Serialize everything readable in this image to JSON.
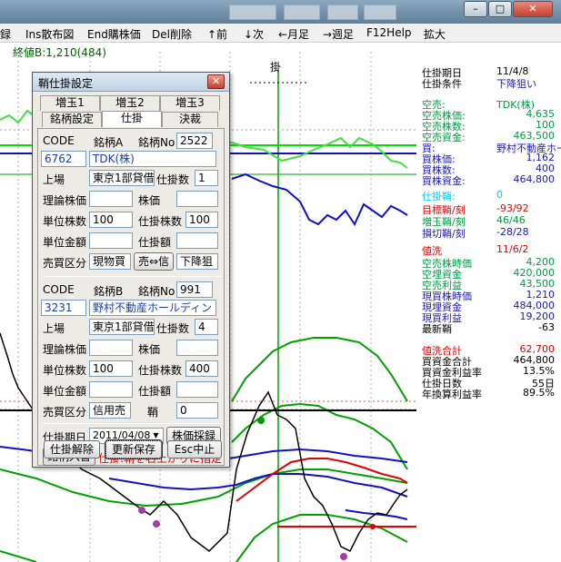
{
  "titlebar": {
    "window_controls": {
      "minimize": "–",
      "maximize": "□",
      "close": "✕"
    }
  },
  "menu": {
    "items": [
      "録",
      "Ins散布図",
      "End購株価",
      "Del削除",
      "↑前",
      "↓次",
      "←月足",
      "→週足",
      "F12Help",
      "拡大"
    ]
  },
  "chart": {
    "label": "終値B:1,210(484)",
    "marker": "掛"
  },
  "info": {
    "rows": [
      {
        "label": "仕掛期日",
        "value": "11/4/8",
        "color": "#000000",
        "align": "left"
      },
      {
        "label": "仕掛条件",
        "value": "下降狙い",
        "color": "#000000",
        "value_color": "#1a1ab0",
        "align": "left"
      },
      {
        "label": "空売:",
        "value": "TDK(株)",
        "color": "#009a40",
        "align": "left"
      },
      {
        "label": "空売株価:",
        "value": "4,635",
        "color": "#009a40"
      },
      {
        "label": "空売株数:",
        "value": "100",
        "color": "#009a40"
      },
      {
        "label": "空売資金:",
        "value": "463,500",
        "color": "#009a40"
      },
      {
        "label": "買:",
        "value": "野村不動産ホール",
        "color": "#1a1ab0",
        "align": "left"
      },
      {
        "label": "買株価:",
        "value": "1,162",
        "color": "#1a1ab0"
      },
      {
        "label": "買株数:",
        "value": "400",
        "color": "#1a1ab0"
      },
      {
        "label": "買株資金:",
        "value": "464,800",
        "color": "#1a1ab0"
      },
      {
        "label": "仕掛鞘:",
        "value": "0",
        "color": "#00c8f0",
        "align": "left"
      },
      {
        "label": "目標鞘/刻",
        "value": "-93/92",
        "color": "#e00000",
        "align": "left"
      },
      {
        "label": "増玉鞘/刻",
        "value": "46/46",
        "color": "#009a40",
        "align": "left"
      },
      {
        "label": "損切鞘/刻",
        "value": "-28/28",
        "color": "#1a1ab0",
        "align": "left"
      },
      {
        "label": "値洗",
        "value": "11/6/2",
        "color": "#e00000",
        "align": "left"
      },
      {
        "label": "空売株時価",
        "value": "4,200",
        "color": "#009a40"
      },
      {
        "label": "空埋資金",
        "value": "420,000",
        "color": "#009a40"
      },
      {
        "label": "空売利益",
        "value": "43,500",
        "color": "#009a40"
      },
      {
        "label": "現買株時価",
        "value": "1,210",
        "color": "#1a1ab0"
      },
      {
        "label": "現埋資金",
        "value": "484,000",
        "color": "#1a1ab0"
      },
      {
        "label": "現買利益",
        "value": "19,200",
        "color": "#1a1ab0"
      },
      {
        "label": "最新鞘",
        "value": "-63",
        "color": "#000000"
      },
      {
        "label": "値洗合計",
        "value": "62,700",
        "color": "#e00000"
      },
      {
        "label": "買資金合計",
        "value": "464,800",
        "color": "#000000"
      },
      {
        "label": "買資金利益率",
        "value": "13.5%",
        "color": "#000000"
      },
      {
        "label": "仕掛日数",
        "value": "55日",
        "color": "#000000"
      },
      {
        "label": "年換算利益率",
        "value": "89.5%",
        "color": "#000000"
      }
    ]
  },
  "dialog": {
    "title": "鞘仕掛設定",
    "close": "✕",
    "tabs_row1": [
      "増玉1",
      "増玉2",
      "増玉3"
    ],
    "tabs_row2": [
      "銘柄設定",
      "仕掛",
      "決裁"
    ],
    "active_tab": "仕掛",
    "a": {
      "code_label": "CODE",
      "name_label": "銘柄A",
      "no_label": "銘柄No",
      "no_value": "2522",
      "code_value": "6762",
      "name_value": "TDK(株)",
      "market_label": "上場",
      "market_value": "東京1部貸借",
      "count_label": "仕掛数",
      "count_value": "1",
      "theory_label": "理論株価",
      "theory_value": "",
      "price_label": "株価",
      "price_value": "",
      "unit_label": "単位株数",
      "unit_value": "100",
      "shares_label": "仕掛株数",
      "shares_value": "100",
      "unit_amount_label": "単位金額",
      "unit_amount_value": "",
      "amount_label": "仕掛額",
      "amount_value": "",
      "side_label": "売買区分",
      "side_value": "現物買",
      "swap_button": "売⇔信",
      "direction_value": "下降狙"
    },
    "b": {
      "code_label": "CODE",
      "name_label": "銘柄B",
      "no_label": "銘柄No",
      "no_value": "991",
      "code_value": "3231",
      "name_value": "野村不動産ホールディン",
      "market_label": "上場",
      "market_value": "東京1部貸借",
      "count_label": "仕掛数",
      "count_value": "4",
      "theory_label": "理論株価",
      "theory_value": "",
      "price_label": "株価",
      "price_value": "",
      "unit_label": "単位株数",
      "unit_value": "100",
      "shares_label": "仕掛株数",
      "shares_value": "400",
      "unit_amount_label": "単位金額",
      "unit_amount_value": "",
      "amount_label": "仕掛額",
      "amount_value": "",
      "side_label": "売買区分",
      "side_value": "信用売",
      "spread_label": "鞘",
      "spread_value": "0"
    },
    "date_label": "仕掛期日",
    "date_value": "2011/04/08",
    "sample_button": "株価採録",
    "swap_names_button": "銘柄入替",
    "hint": "仕掛:鞘を右上がりに指定",
    "cancel_position_button": "仕掛解除",
    "save_button": "更新保存",
    "esc_button": "Esc中止"
  },
  "colors": {
    "green": "#00a000",
    "light_green": "#40e040",
    "blue": "#1010c0",
    "red": "#e00000",
    "dark_green": "#006000",
    "purple": "#a040a0",
    "cyan": "#30d0e0"
  }
}
